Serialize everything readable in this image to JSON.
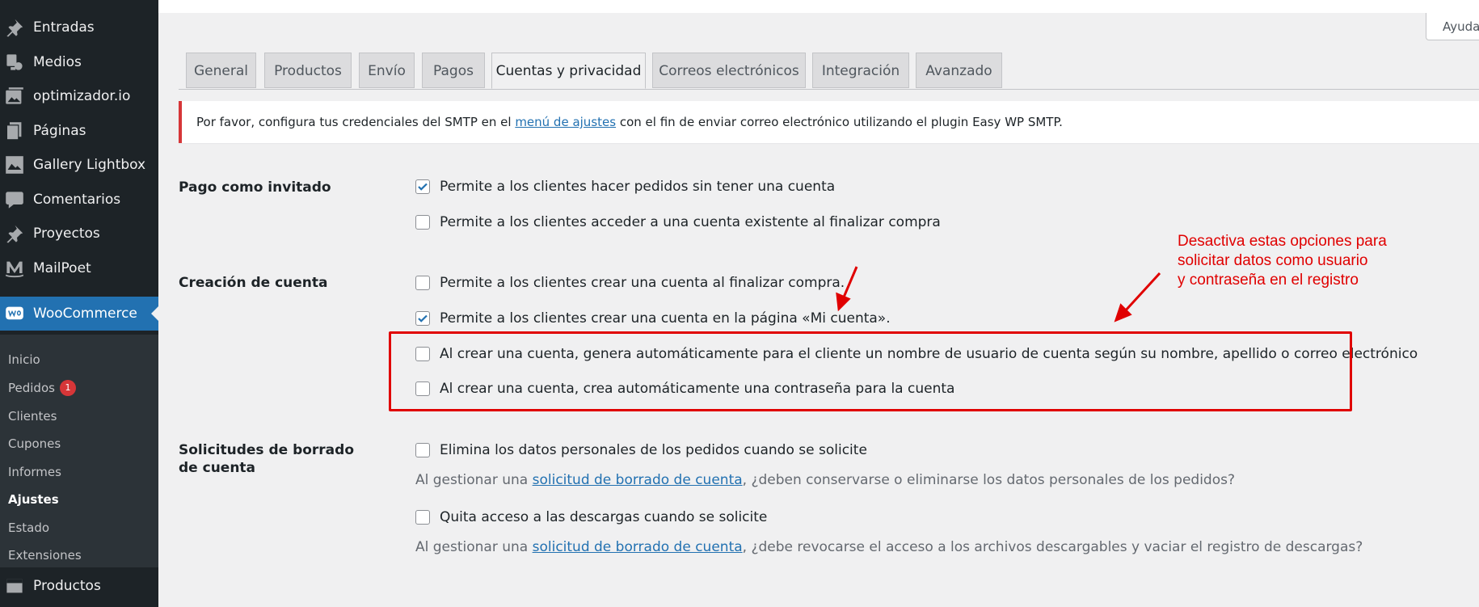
{
  "sidebar": {
    "items": [
      {
        "label": "Entradas",
        "icon": "pin-icon"
      },
      {
        "label": "Medios",
        "icon": "media-icon"
      },
      {
        "label": "optimizador.io",
        "icon": "image-stack-icon"
      },
      {
        "label": "Páginas",
        "icon": "pages-icon"
      },
      {
        "label": "Gallery Lightbox",
        "icon": "gallery-icon"
      },
      {
        "label": "Comentarios",
        "icon": "comment-icon"
      },
      {
        "label": "Proyectos",
        "icon": "pin-icon"
      },
      {
        "label": "MailPoet",
        "icon": "mailpoet-icon"
      },
      {
        "label": "WooCommerce",
        "icon": "woo-icon"
      }
    ],
    "submenu": [
      {
        "label": "Inicio"
      },
      {
        "label": "Pedidos",
        "badge": "1"
      },
      {
        "label": "Clientes"
      },
      {
        "label": "Cupones"
      },
      {
        "label": "Informes"
      },
      {
        "label": "Ajustes"
      },
      {
        "label": "Estado"
      },
      {
        "label": "Extensiones"
      }
    ],
    "bottom_item": {
      "label": "Productos",
      "icon": "box-icon"
    }
  },
  "help_label": "Ayuda",
  "tabs": [
    "General",
    "Productos",
    "Envío",
    "Pagos",
    "Cuentas y privacidad",
    "Correos electrónicos",
    "Integración",
    "Avanzado"
  ],
  "active_tab": "Cuentas y privacidad",
  "notice": {
    "before": "Por favor, configura tus credenciales del SMTP en el ",
    "link": "menú de ajustes",
    "after": " con el fin de enviar correo electrónico utilizando el plugin Easy WP SMTP."
  },
  "settings": {
    "guest_checkout": {
      "label": "Pago como invitado",
      "options": [
        {
          "text": "Permite a los clientes hacer pedidos sin tener una cuenta",
          "checked": true
        },
        {
          "text": "Permite a los clientes acceder a una cuenta existente al finalizar compra",
          "checked": false
        }
      ]
    },
    "account_creation": {
      "label": "Creación de cuenta",
      "options": [
        {
          "text": "Permite a los clientes crear una cuenta al finalizar compra.",
          "checked": false
        },
        {
          "text": "Permite a los clientes crear una cuenta en la página «Mi cuenta».",
          "checked": true
        },
        {
          "text": "Al crear una cuenta, genera automáticamente para el cliente un nombre de usuario de cuenta según su nombre, apellido o correo electrónico",
          "checked": false
        },
        {
          "text": "Al crear una cuenta, crea automáticamente una contraseña para la cuenta",
          "checked": false
        }
      ]
    },
    "erasure": {
      "label": "Solicitudes de borrado de cuenta",
      "options": [
        {
          "text": "Elimina los datos personales de los pedidos cuando se solicite",
          "checked": false
        },
        {
          "text": "Quita acceso a las descargas cuando se solicite",
          "checked": false
        }
      ],
      "desc1": {
        "before": "Al gestionar una ",
        "link": "solicitud de borrado de cuenta",
        "after": ", ¿deben conservarse o eliminarse los datos personales de los pedidos?"
      },
      "desc2": {
        "before": "Al gestionar una ",
        "link": "solicitud de borrado de cuenta",
        "after": ", ¿debe revocarse el acceso a los archivos descargables y vaciar el registro de descargas?"
      }
    }
  },
  "annotation": "Desactiva estas opciones para\nsolicitar datos como usuario\ny contraseña en el registro",
  "colors": {
    "accent": "#2271b1",
    "annotation": "#e00000",
    "sidebar": "#1d2327",
    "error": "#d63638"
  }
}
